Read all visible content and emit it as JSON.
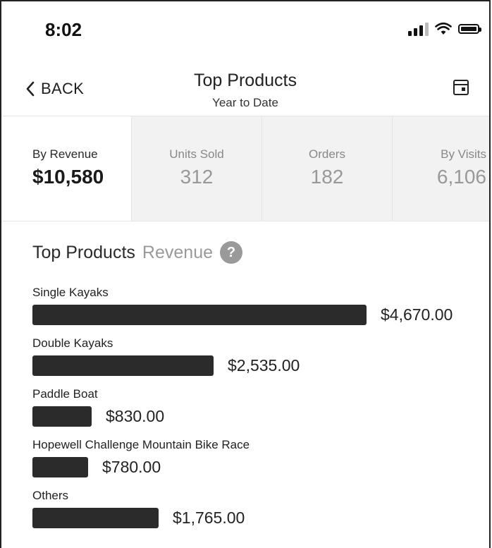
{
  "status_bar": {
    "time": "8:02"
  },
  "nav": {
    "back_label": "BACK",
    "title": "Top Products",
    "subtitle": "Year to Date",
    "calendar_icon": "calendar-icon"
  },
  "metrics": [
    {
      "label": "By Revenue",
      "value": "$10,580",
      "active": true
    },
    {
      "label": "Units Sold",
      "value": "312",
      "active": false
    },
    {
      "label": "Orders",
      "value": "182",
      "active": false
    },
    {
      "label": "By Visits",
      "value": "6,106",
      "active": false
    }
  ],
  "section": {
    "title": "Top Products",
    "subtitle": "Revenue",
    "help_label": "?"
  },
  "chart_data": {
    "type": "bar",
    "orientation": "horizontal",
    "categories": [
      "Single Kayaks",
      "Double Kayaks",
      "Paddle Boat",
      "Hopewell Challenge Mountain Bike Race",
      "Others"
    ],
    "values": [
      4670,
      2535,
      830,
      780,
      1765
    ],
    "value_labels": [
      "$4,670.00",
      "$2,535.00",
      "$830.00",
      "$780.00",
      "$1,765.00"
    ],
    "bar_color": "#2b2b2b"
  }
}
